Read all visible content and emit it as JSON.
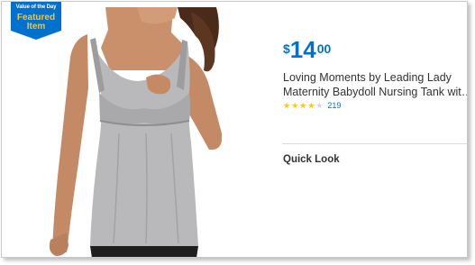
{
  "badge": {
    "line1": "Value of the Day",
    "line2": "Featured",
    "line3": "Item",
    "bg_color": "#0071ce",
    "text_color": "#ffc220"
  },
  "product": {
    "image_icon": "product-photo",
    "price": {
      "currency": "$",
      "dollars": "14",
      "cents": "00",
      "color": "#0071ce"
    },
    "title_line1": "Loving Moments by Leading Lady",
    "title_line2": "Maternity Babydoll Nursing Tank with...",
    "rating": {
      "stars": 4,
      "max": 5,
      "review_count": "219"
    }
  },
  "quick_look": {
    "label": "Quick Look"
  }
}
